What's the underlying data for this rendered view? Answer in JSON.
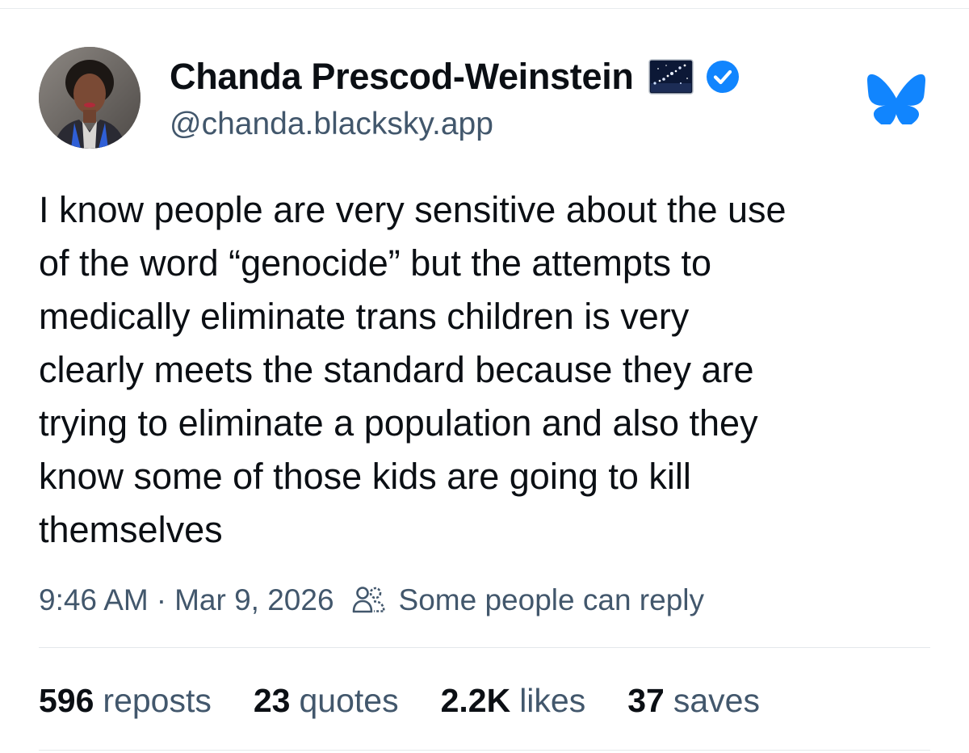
{
  "author": {
    "display_name": "Chanda Prescod-Weinstein",
    "handle": "@chanda.blacksky.app",
    "name_emoji": "night-sky-stars-emoji",
    "verified": true
  },
  "brand": {
    "icon": "bluesky-butterfly-icon",
    "color": "#1185fe"
  },
  "post": {
    "text": "I know people are very sensitive about the use\nof the word “genocide” but the attempts to\nmedically eliminate trans children is very\nclearly meets the standard because they are\ntrying to eliminate a population and also they\nknow some of those kids are going to kill\nthemselves",
    "time": "9:46 AM",
    "separator": "·",
    "date": "Mar 9, 2026",
    "reply_setting_icon": "people-icon",
    "reply_setting": "Some people can reply"
  },
  "stats": [
    {
      "count": "596",
      "label": "reposts"
    },
    {
      "count": "23",
      "label": "quotes"
    },
    {
      "count": "2.2K",
      "label": "likes"
    },
    {
      "count": "37",
      "label": "saves"
    }
  ],
  "colors": {
    "text_primary": "#0b0f14",
    "text_secondary": "#42576c",
    "verified_blue": "#1185fe",
    "divider": "#e4e8eb"
  }
}
